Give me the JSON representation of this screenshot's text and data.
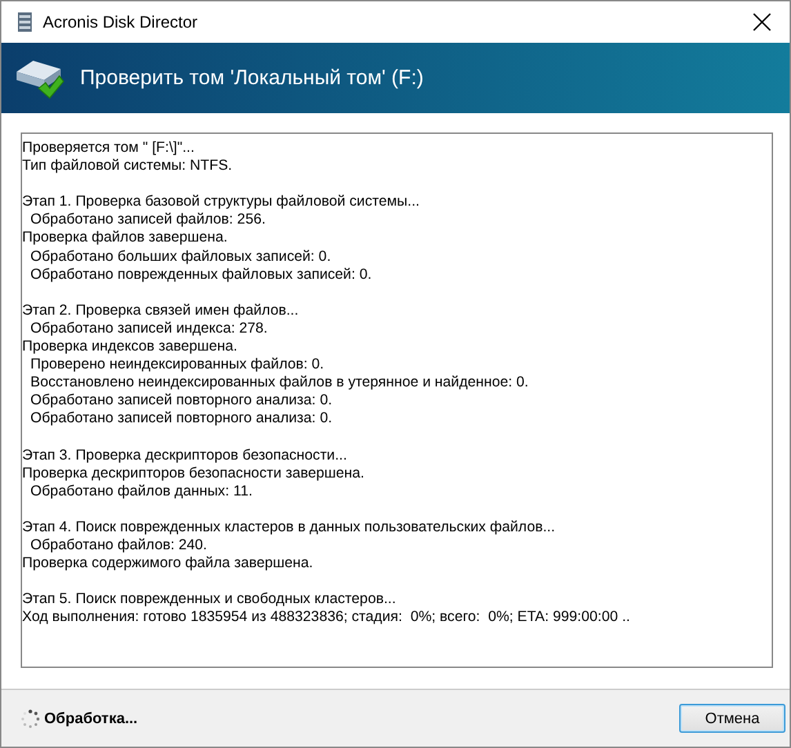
{
  "window": {
    "title": "Acronis Disk Director"
  },
  "header": {
    "title": "Проверить том 'Локальный том' (F:)"
  },
  "log": [
    [
      {
        "text": "Проверяется том \" [F:\\]\"...",
        "indented": false
      },
      {
        "text": "Тип файловой системы: NTFS.",
        "indented": false
      }
    ],
    [
      {
        "text": "Этап 1. Проверка базовой структуры файловой системы...",
        "indented": false
      },
      {
        "text": "Обработано записей файлов: 256.",
        "indented": true
      },
      {
        "text": "Проверка файлов завершена.",
        "indented": false
      },
      {
        "text": "Обработано больших файловых записей: 0.",
        "indented": true
      },
      {
        "text": "Обработано поврежденных файловых записей: 0.",
        "indented": true
      }
    ],
    [
      {
        "text": "Этап 2. Проверка связей имен файлов...",
        "indented": false
      },
      {
        "text": "Обработано записей индекса: 278.",
        "indented": true
      },
      {
        "text": "Проверка индексов завершена.",
        "indented": false
      },
      {
        "text": "Проверено неиндексированных файлов: 0.",
        "indented": true
      },
      {
        "text": "Восстановлено неиндексированных файлов в утерянное и найденное: 0.",
        "indented": true
      },
      {
        "text": "Обработано записей повторного анализа: 0.",
        "indented": true
      },
      {
        "text": "Обработано записей повторного анализа: 0.",
        "indented": true
      }
    ],
    [
      {
        "text": "Этап 3. Проверка дескрипторов безопасности...",
        "indented": false
      },
      {
        "text": "Проверка дескрипторов безопасности завершена.",
        "indented": false
      },
      {
        "text": "Обработано файлов данных: 11.",
        "indented": true
      }
    ],
    [
      {
        "text": "Этап 4. Поиск поврежденных кластеров в данных пользовательских файлов...",
        "indented": false
      },
      {
        "text": "Обработано файлов: 240.",
        "indented": true
      },
      {
        "text": "Проверка содержимого файла завершена.",
        "indented": false
      }
    ],
    [
      {
        "text": "Этап 5. Поиск поврежденных и свободных кластеров...",
        "indented": false
      },
      {
        "text": "Ход выполнения: готово 1835954 из 488323836; стадия:  0%; всего:  0%; ETA: 999:00:00 ..",
        "indented": false
      }
    ]
  ],
  "status": {
    "text": "Обработка..."
  },
  "buttons": [
    {
      "label": "Отмена",
      "focused": true
    }
  ]
}
